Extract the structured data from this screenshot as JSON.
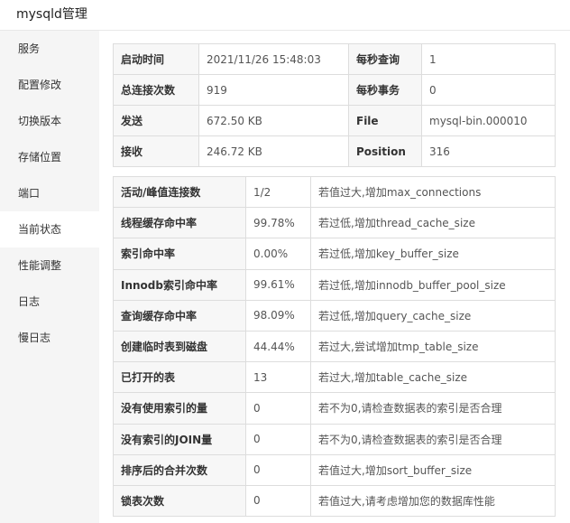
{
  "window": {
    "title": "mysqld管理"
  },
  "sidebar": {
    "items": [
      {
        "label": "服务"
      },
      {
        "label": "配置修改"
      },
      {
        "label": "切换版本"
      },
      {
        "label": "存储位置"
      },
      {
        "label": "端口"
      },
      {
        "label": "当前状态",
        "active": true
      },
      {
        "label": "性能调整"
      },
      {
        "label": "日志"
      },
      {
        "label": "慢日志"
      }
    ]
  },
  "summary": {
    "rows": [
      {
        "k1": "启动时间",
        "v1": "2021/11/26 15:48:03",
        "k2": "每秒查询",
        "v2": "1"
      },
      {
        "k1": "总连接次数",
        "v1": "919",
        "k2": "每秒事务",
        "v2": "0"
      },
      {
        "k1": "发送",
        "v1": "672.50 KB",
        "k2": "File",
        "v2": "mysql-bin.000010"
      },
      {
        "k1": "接收",
        "v1": "246.72 KB",
        "k2": "Position",
        "v2": "316"
      }
    ]
  },
  "metrics": {
    "rows": [
      {
        "name": "活动/峰值连接数",
        "value": "1/2",
        "advice": "若值过大,增加max_connections"
      },
      {
        "name": "线程缓存命中率",
        "value": "99.78%",
        "advice": "若过低,增加thread_cache_size"
      },
      {
        "name": "索引命中率",
        "value": "0.00%",
        "advice": "若过低,增加key_buffer_size"
      },
      {
        "name": "Innodb索引命中率",
        "value": "99.61%",
        "advice": "若过低,增加innodb_buffer_pool_size"
      },
      {
        "name": "查询缓存命中率",
        "value": "98.09%",
        "advice": "若过低,增加query_cache_size"
      },
      {
        "name": "创建临时表到磁盘",
        "value": "44.44%",
        "advice": "若过大,尝试增加tmp_table_size"
      },
      {
        "name": "已打开的表",
        "value": "13",
        "advice": "若过大,增加table_cache_size"
      },
      {
        "name": "没有使用索引的量",
        "value": "0",
        "advice": "若不为0,请检查数据表的索引是否合理"
      },
      {
        "name": "没有索引的JOIN量",
        "value": "0",
        "advice": "若不为0,请检查数据表的索引是否合理"
      },
      {
        "name": "排序后的合并次数",
        "value": "0",
        "advice": "若值过大,增加sort_buffer_size"
      },
      {
        "name": "锁表次数",
        "value": "0",
        "advice": "若值过大,请考虑增加您的数据库性能"
      }
    ]
  }
}
